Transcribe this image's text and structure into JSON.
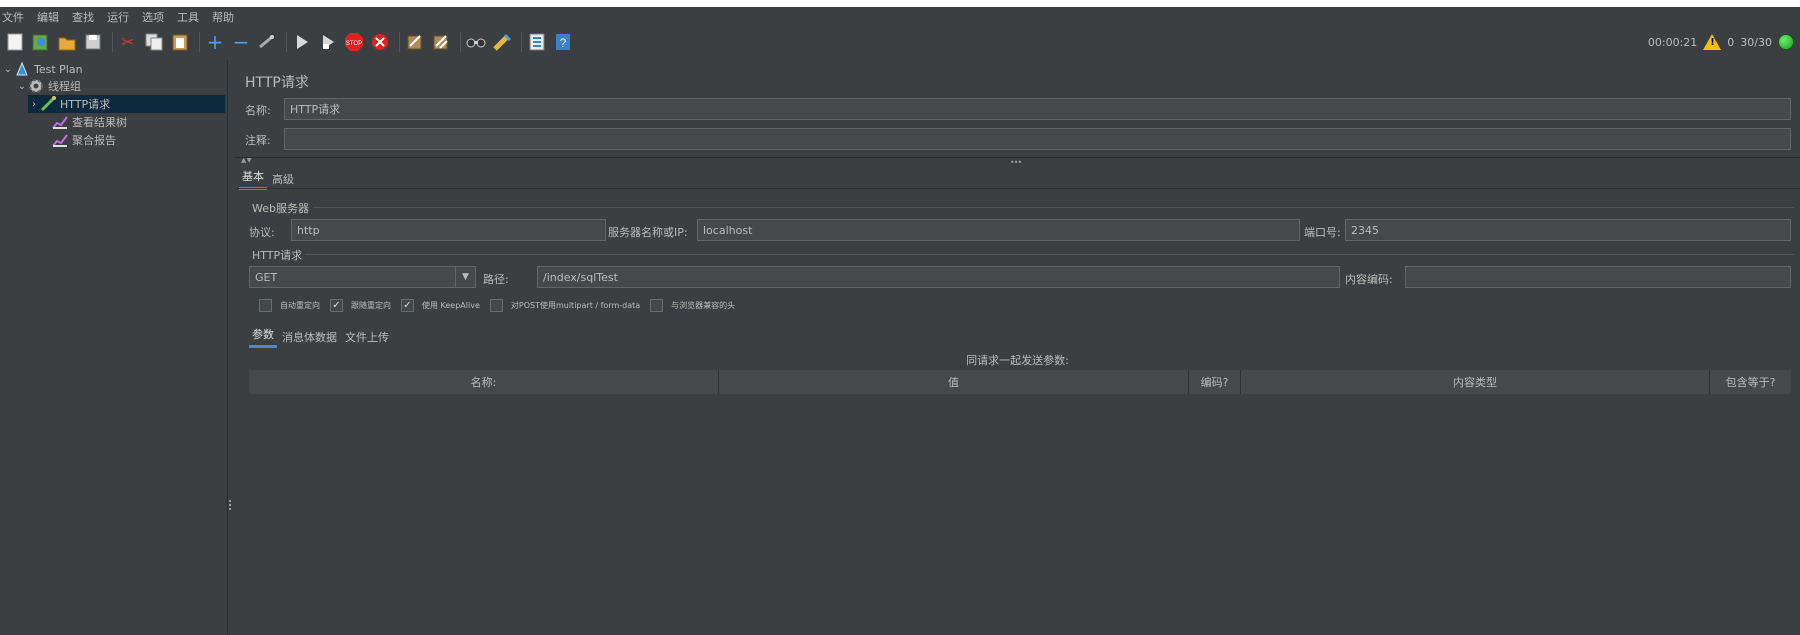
{
  "menubar": {
    "items": [
      "文件",
      "编辑",
      "查找",
      "运行",
      "选项",
      "工具",
      "帮助"
    ]
  },
  "toolbar": {
    "icons": [
      "new-icon",
      "templates-icon",
      "open-icon",
      "save-icon",
      "cut-icon",
      "copy-icon",
      "paste-icon",
      "expand-icon",
      "collapse-icon",
      "toggle-icon",
      "start-icon",
      "start-no-pause-icon",
      "stop-icon",
      "shutdown-icon",
      "clear-icon",
      "clear-all-icon",
      "search-icon",
      "reset-search-icon",
      "function-helper-icon",
      "help-icon"
    ],
    "elapsed_time": "00:00:21",
    "warning_count": "0",
    "threads": "30/30"
  },
  "tree": {
    "items": [
      {
        "label": "Test Plan",
        "icon": "test-plan-icon",
        "level": 0,
        "expanded": true
      },
      {
        "label": "线程组",
        "icon": "thread-group-icon",
        "level": 1,
        "expanded": true
      },
      {
        "label": "HTTP请求",
        "icon": "sampler-icon",
        "level": 2,
        "selected": true
      },
      {
        "label": "查看结果树",
        "icon": "listener-icon",
        "level": 2
      },
      {
        "label": "聚合报告",
        "icon": "listener-icon",
        "level": 2
      }
    ]
  },
  "panel": {
    "title": "HTTP请求",
    "name_label": "名称:",
    "name_value": "HTTP请求",
    "comment_label": "注释:",
    "comment_value": "",
    "tabs": [
      "基本",
      "高级"
    ],
    "active_tab": "基本"
  },
  "web_server": {
    "title": "Web服务器",
    "protocol_label": "协议:",
    "protocol_value": "http",
    "server_label": "服务器名称或IP:",
    "server_value": "localhost",
    "port_label": "端口号:",
    "port_value": "2345"
  },
  "http_request": {
    "title": "HTTP请求",
    "method": "GET",
    "path_label": "路径:",
    "path_value": "/index/sqlTest",
    "encoding_label": "内容编码:",
    "encoding_value": "",
    "options": [
      {
        "label": "自动重定向",
        "checked": false
      },
      {
        "label": "跟随重定向",
        "checked": true
      },
      {
        "label": "使用 KeepAlive",
        "checked": true
      },
      {
        "label": "对POST使用multipart / form-data",
        "checked": false
      },
      {
        "label": "与浏览器兼容的头",
        "checked": false
      }
    ]
  },
  "params": {
    "tabs": [
      "参数",
      "消息体数据",
      "文件上传"
    ],
    "active_tab": "参数",
    "caption": "同请求一起发送参数:",
    "columns": [
      "名称:",
      "值",
      "编码?",
      "内容类型",
      "包含等于?"
    ]
  },
  "colors": {
    "background": "#3c3f41",
    "input_bg": "#45494a",
    "accent": "#4a88c7",
    "selection": "#0d293e"
  }
}
